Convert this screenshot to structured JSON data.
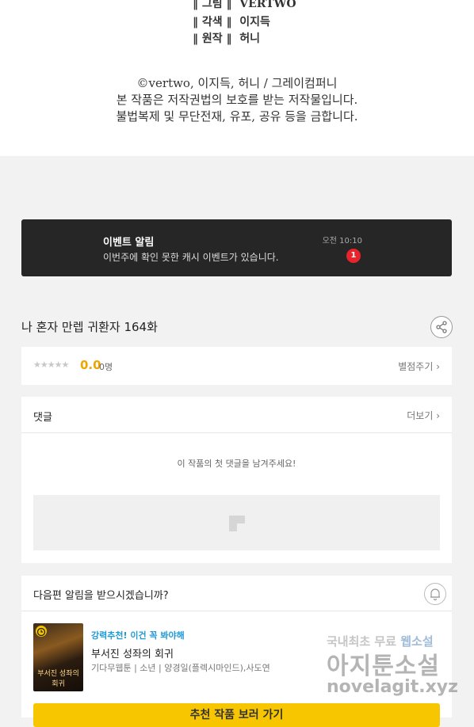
{
  "credits": {
    "staff": [
      {
        "role": "‖ 그림 ‖",
        "name": "VERTWO"
      },
      {
        "role": "‖ 각색 ‖",
        "name": "이지득"
      },
      {
        "role": "‖ 원작 ‖",
        "name": "허니"
      }
    ],
    "copyright": "©vertwo, 이지득, 허니 / 그레이컴퍼니",
    "notice1": "본 작품은 저작권법의 보호를 받는 저작물입니다.",
    "notice2": "불법복제 및 무단전재, 유포, 공유 등을 금합니다."
  },
  "event": {
    "title": "이벤트 알림",
    "message": "이번주에 확인 못한 캐시 이벤트가 있습니다.",
    "time": "오전 10:10",
    "badge": "1"
  },
  "episode": {
    "title": "나 혼자 만렙 귀환자 164화",
    "stars": "★★★★★",
    "score": "0.0",
    "count": "0명",
    "rate_link": "별점주기 ›"
  },
  "comments": {
    "label": "댓글",
    "more": "더보기 ›",
    "empty": "이 작품의 첫 댓글을 남겨주세요!"
  },
  "notify": {
    "question": "다음편 알림을 받으시겠습니까?",
    "rec_tag": "강력추천! 이건 꼭 봐야해",
    "rec_title": "부서진 성좌의 회귀",
    "rec_meta": "기다무웹툰 | 소년 | 양경일(플렉시마인드),사도연",
    "thumb_title": "부서진 성좌의 회귀",
    "cta": "추천 작품 보러 가기"
  },
  "watermark": {
    "line1_a": "국내최초 무료 ",
    "line1_b": "웹소설",
    "line2": "아지툰소설",
    "line3": "novelagit.xyz"
  }
}
